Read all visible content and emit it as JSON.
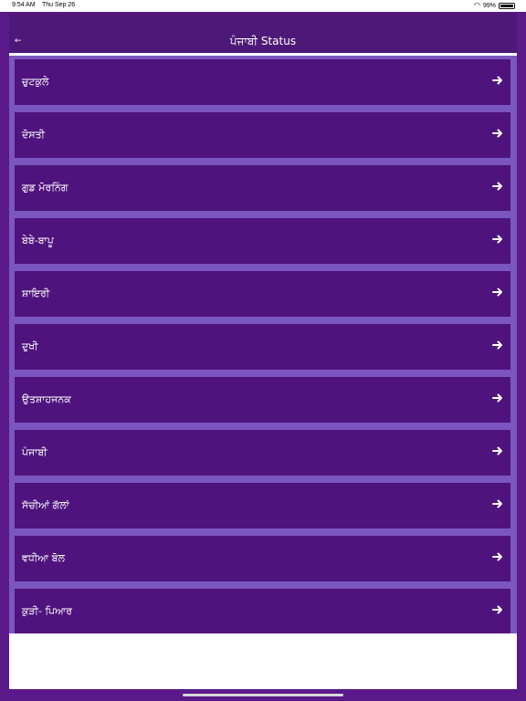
{
  "status_bar": {
    "time": "9:54 AM",
    "date": "Thu Sep 26",
    "battery": "99%"
  },
  "header": {
    "title": "ਪੰਜਾਬੀ Status",
    "back_icon": "back-arrow-icon"
  },
  "list": {
    "items": [
      {
        "label": "ਚੁਟਕੁਲੇ"
      },
      {
        "label": "ਦੋਸਤੀ"
      },
      {
        "label": "ਗੁਡ ਮੋਰਨਿੰਗ"
      },
      {
        "label": "ਬੇਬੇ-ਬਾਪੂ"
      },
      {
        "label": "ਸ਼ਾਇਰੀ"
      },
      {
        "label": "ਦੁਖੀ"
      },
      {
        "label": "ਉਤਸ਼ਾਹਜਨਕ"
      },
      {
        "label": "ਪੰਜਾਬੀ"
      },
      {
        "label": "ਸੱਚੀਆਂ ਗੱਲਾਂ"
      },
      {
        "label": "ਵਧੀਆ ਬੋਲ"
      },
      {
        "label": "ਕੁੜੀ- ਪਿਆਰ"
      }
    ],
    "arrow_icon": "right-arrow-icon"
  },
  "colors": {
    "accent": "#4e1878",
    "row": "#4f137e",
    "list_background": "#7b55c0"
  }
}
